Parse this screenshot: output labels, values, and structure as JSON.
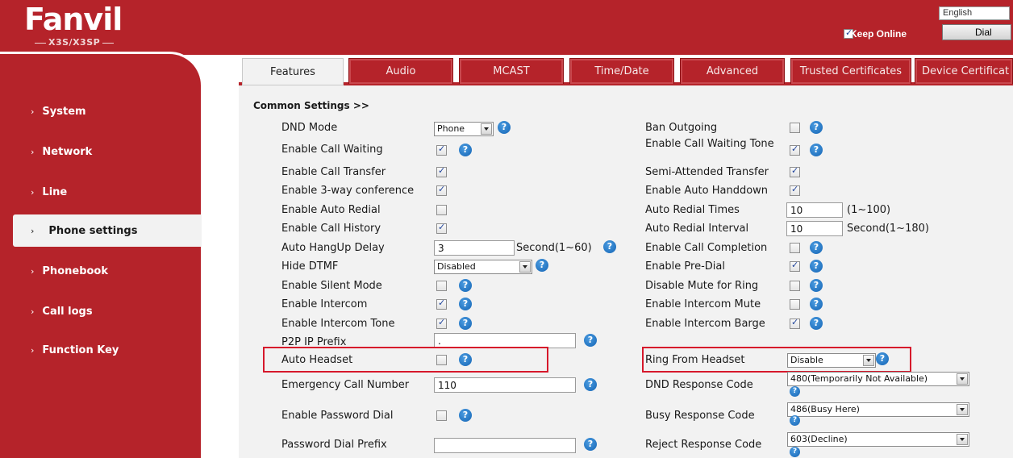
{
  "header": {
    "brand": "Fanvil",
    "model": "X3S/X3SP",
    "language": "English",
    "keep_online_label": "Keep Online",
    "keep_online_checked": true,
    "dial_label": "Dial"
  },
  "sidebar": {
    "items": [
      {
        "label": "System"
      },
      {
        "label": "Network"
      },
      {
        "label": "Line"
      },
      {
        "label": "Phone settings",
        "active": true
      },
      {
        "label": "Phonebook"
      },
      {
        "label": "Call logs"
      },
      {
        "label": "Function Key"
      }
    ]
  },
  "tabs": [
    {
      "label": "Features",
      "active": true
    },
    {
      "label": "Audio"
    },
    {
      "label": "MCAST"
    },
    {
      "label": "Time/Date"
    },
    {
      "label": "Advanced"
    },
    {
      "label": "Trusted Certificates"
    },
    {
      "label": "Device Certificat"
    }
  ],
  "section_title": "Common Settings >>",
  "left": {
    "dnd_mode": {
      "label": "DND Mode",
      "value": "Phone"
    },
    "call_waiting": {
      "label": "Enable Call Waiting",
      "checked": true
    },
    "call_transfer": {
      "label": "Enable Call Transfer",
      "checked": true
    },
    "three_way": {
      "label": "Enable 3-way conference",
      "checked": true
    },
    "auto_redial": {
      "label": "Enable Auto Redial",
      "checked": false
    },
    "call_history": {
      "label": "Enable Call History",
      "checked": true
    },
    "hangup_delay": {
      "label": "Auto HangUp Delay",
      "value": "3",
      "suffix": "Second(1~60)"
    },
    "hide_dtmf": {
      "label": "Hide DTMF",
      "value": "Disabled"
    },
    "silent_mode": {
      "label": "Enable Silent Mode",
      "checked": false
    },
    "intercom": {
      "label": "Enable Intercom",
      "checked": true
    },
    "intercom_tone": {
      "label": "Enable Intercom Tone",
      "checked": true
    },
    "p2p_prefix": {
      "label": "P2P IP Prefix",
      "value": "."
    },
    "auto_headset": {
      "label": "Auto Headset",
      "checked": false
    },
    "emergency": {
      "label": "Emergency Call Number",
      "value": "110"
    },
    "password_dial": {
      "label": "Enable Password Dial",
      "checked": false
    },
    "password_prefix": {
      "label": "Password Dial Prefix",
      "value": ""
    }
  },
  "right": {
    "ban_outgoing": {
      "label": "Ban Outgoing",
      "checked": false
    },
    "waiting_tone": {
      "label": "Enable Call Waiting Tone",
      "checked": true
    },
    "semi_transfer": {
      "label": "Semi-Attended Transfer",
      "checked": true
    },
    "auto_handdown": {
      "label": "Enable Auto Handdown",
      "checked": true
    },
    "redial_times": {
      "label": "Auto Redial Times",
      "value": "10",
      "suffix": "(1~100)"
    },
    "redial_interval": {
      "label": "Auto Redial Interval",
      "value": "10",
      "suffix": "Second(1~180)"
    },
    "call_completion": {
      "label": "Enable Call Completion",
      "checked": false
    },
    "pre_dial": {
      "label": "Enable Pre-Dial",
      "checked": true
    },
    "mute_ring": {
      "label": "Disable Mute for Ring",
      "checked": false
    },
    "intercom_mute": {
      "label": "Enable Intercom Mute",
      "checked": false
    },
    "intercom_barge": {
      "label": "Enable Intercom Barge",
      "checked": true
    },
    "ring_headset": {
      "label": "Ring From Headset",
      "value": "Disable"
    },
    "dnd_code": {
      "label": "DND Response Code",
      "value": "480(Temporarily Not Available)"
    },
    "busy_code": {
      "label": "Busy Response Code",
      "value": "486(Busy Here)"
    },
    "reject_code": {
      "label": "Reject Response Code",
      "value": "603(Decline)"
    }
  },
  "icons": {
    "help": "?"
  },
  "colors": {
    "brand_red": "#b5232a",
    "highlight": "#d6182b",
    "help_blue": "#1565b5"
  }
}
